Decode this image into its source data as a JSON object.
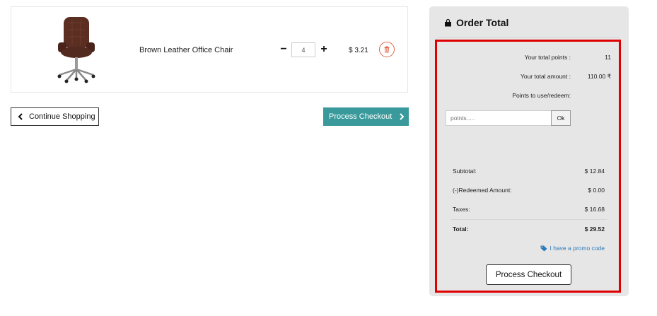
{
  "cart": {
    "item": {
      "name": "Brown Leather Office Chair",
      "quantity": "4",
      "price": "$ 3.21",
      "image_icon": "office-chair-image",
      "delete_icon": "trash-icon"
    },
    "continue_label": "Continue Shopping",
    "continue_icon": "chevron-left-icon",
    "checkout_label": "Process Checkout",
    "checkout_icon": "chevron-right-icon"
  },
  "order": {
    "title": "Order Total",
    "title_icon": "shopping-bag-icon",
    "points": {
      "total_points_label": "Your total points :",
      "total_points_value": "11",
      "total_amount_label": "Your total amount :",
      "total_amount_value": "110.00 ₹",
      "redeem_label": "Points to use/redeem:",
      "input_placeholder": "points.....",
      "ok_label": "Ok"
    },
    "summary": {
      "subtotal_label": "Subtotal:",
      "subtotal_value": "$ 12.84",
      "redeemed_label": "(-)Redeemed Amount:",
      "redeemed_value": "$ 0.00",
      "taxes_label": "Taxes:",
      "taxes_value": "$ 16.68",
      "total_label": "Total:",
      "total_value": "$ 29.52"
    },
    "promo_label": "I have a promo code",
    "promo_icon": "tag-icon",
    "checkout_label": "Process Checkout"
  },
  "colors": {
    "accent_teal": "#3a9a9b",
    "highlight_red": "#e00000",
    "delete_orange": "#e0664a",
    "link_blue": "#2b7ab8",
    "panel_gray": "#e6e6e6"
  }
}
